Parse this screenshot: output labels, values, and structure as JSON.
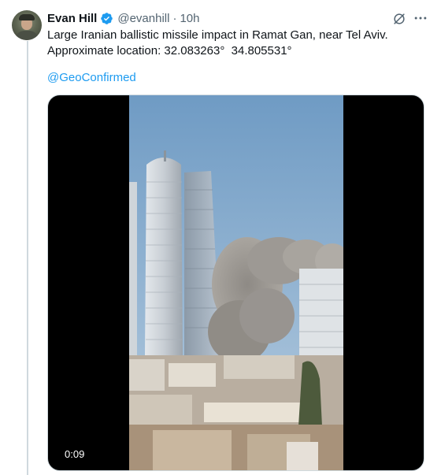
{
  "author": {
    "name": "Evan Hill",
    "handle": "@evanhill",
    "separator": "·",
    "time": "10h",
    "avatar_icon": "avatar-photo",
    "verified_icon": "verified-badge-icon"
  },
  "tweet": {
    "line1": "Large Iranian ballistic missile impact in Ramat Gan, near Tel Aviv.",
    "line2": "Approximate location: 32.083263°  34.805531°",
    "mention": "@GeoConfirmed"
  },
  "media": {
    "duration": "0:09",
    "description_icon": "video-thumbnail"
  },
  "actions": {
    "grok_icon": "grok-icon",
    "more_icon": "more-options-icon"
  },
  "colors": {
    "accent": "#1d9bf0",
    "text": "#0f1419",
    "muted": "#536471",
    "border": "#cfd9de"
  }
}
